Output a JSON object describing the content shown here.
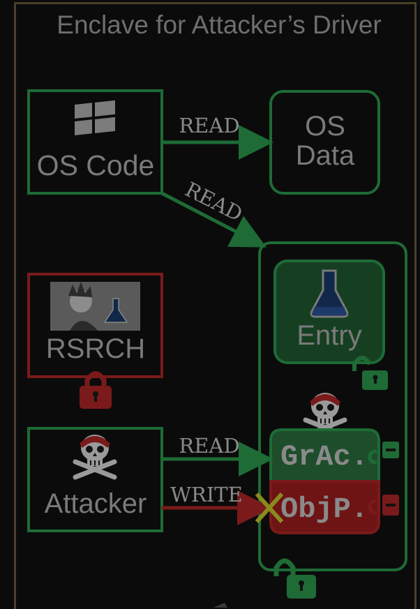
{
  "title": "Enclave for Attacker’s Driver",
  "nodes": {
    "os_code": "OS Code",
    "os_data_line1": "OS",
    "os_data_line2": "Data",
    "rsrch": "RSRCH",
    "attacker": "Attacker",
    "entry": "Entry",
    "grac": "GrAc.",
    "objp": "ObjP."
  },
  "arrows": {
    "os_code_to_os_data": "READ",
    "os_code_to_enclave": "READ",
    "attacker_to_grac": "READ",
    "attacker_to_objp": "WRITE"
  },
  "colors": {
    "green": "#1e6b36",
    "red": "#7a1a1a",
    "entry_fill": "#163f22",
    "grac_fill": "#1d4d2a",
    "objp_fill": "#6e1414",
    "cross": "#8a8a1e"
  },
  "icons": [
    "windows-logo-icon",
    "flask-icon",
    "researcher-avatar-icon",
    "pirate-skull-icon",
    "padlock-open-icon",
    "padlock-closed-icon",
    "cross-mark-icon"
  ]
}
